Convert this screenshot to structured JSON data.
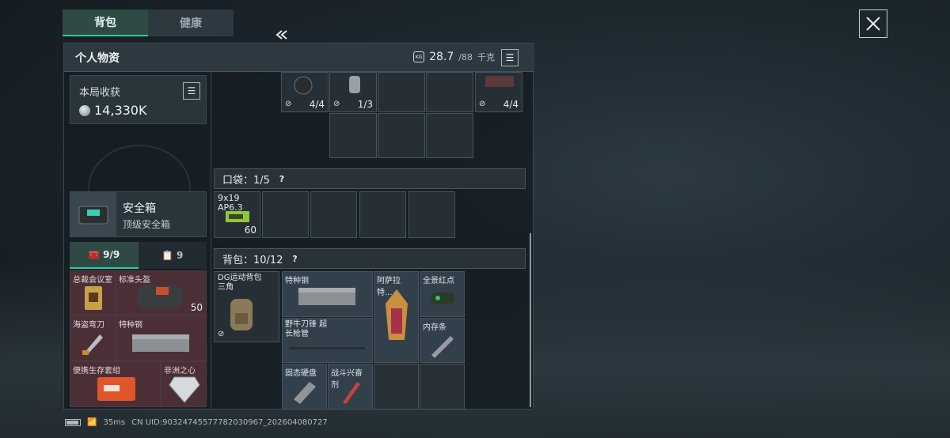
{
  "tabs": [
    {
      "label": "背包",
      "active": true
    },
    {
      "label": "健康",
      "active": false
    }
  ],
  "panel": {
    "title": "个人物资",
    "weight_value": "28.7",
    "weight_max": "/88",
    "weight_unit": "千克"
  },
  "harvest": {
    "label": "本局收获",
    "value": "14,330K"
  },
  "safebox": {
    "name": "安全箱",
    "type": "顶级安全箱"
  },
  "subtabs": [
    {
      "label": "9/9",
      "icon": "toolbox-icon"
    },
    {
      "label": "9",
      "icon": "clipboard-icon"
    }
  ],
  "loadout": [
    {
      "name": "总裁会议室",
      "icon": "keycard-icon"
    },
    {
      "name": "标准头盔",
      "count": "50",
      "icon": "helmet-icon"
    },
    {
      "name": "海盗弯刀",
      "icon": "knife-icon"
    },
    {
      "name": "特种钢",
      "icon": "steel-bar-icon"
    },
    {
      "name": "便携生存套组",
      "icon": "survival-kit-icon"
    },
    {
      "name": "非洲之心",
      "icon": "diamond-icon"
    }
  ],
  "top_grid": [
    {
      "count": "4/4",
      "icon": "grenade-icon"
    },
    {
      "count": "1/3",
      "icon": "canister-icon"
    },
    {
      "count": "4/4",
      "icon": "gear-pack-icon"
    }
  ],
  "pocket": {
    "title": "口袋：1/5",
    "ammo_label": "9x19 AP6.3",
    "ammo_count": "60"
  },
  "backpack": {
    "title": "背包：10/12",
    "bag_label": "DG运动背包 三角",
    "items": [
      {
        "name": "特种钢",
        "icon": "steel-bar-icon"
      },
      {
        "name": "阿萨拉特...",
        "icon": "lantern-icon"
      },
      {
        "name": "全景红点",
        "icon": "red-dot-sight-icon"
      },
      {
        "name": "野牛刀锋 超长枪管",
        "icon": "barrel-icon"
      },
      {
        "name": "内存条",
        "icon": "ram-stick-icon"
      },
      {
        "name": "固态硬盘",
        "icon": "ssd-icon"
      },
      {
        "name": "战斗兴奋剂",
        "icon": "syringe-icon"
      }
    ]
  },
  "footer": {
    "ping": "35ms",
    "uid": "CN UID:903247455777820309​67_202604080727"
  }
}
